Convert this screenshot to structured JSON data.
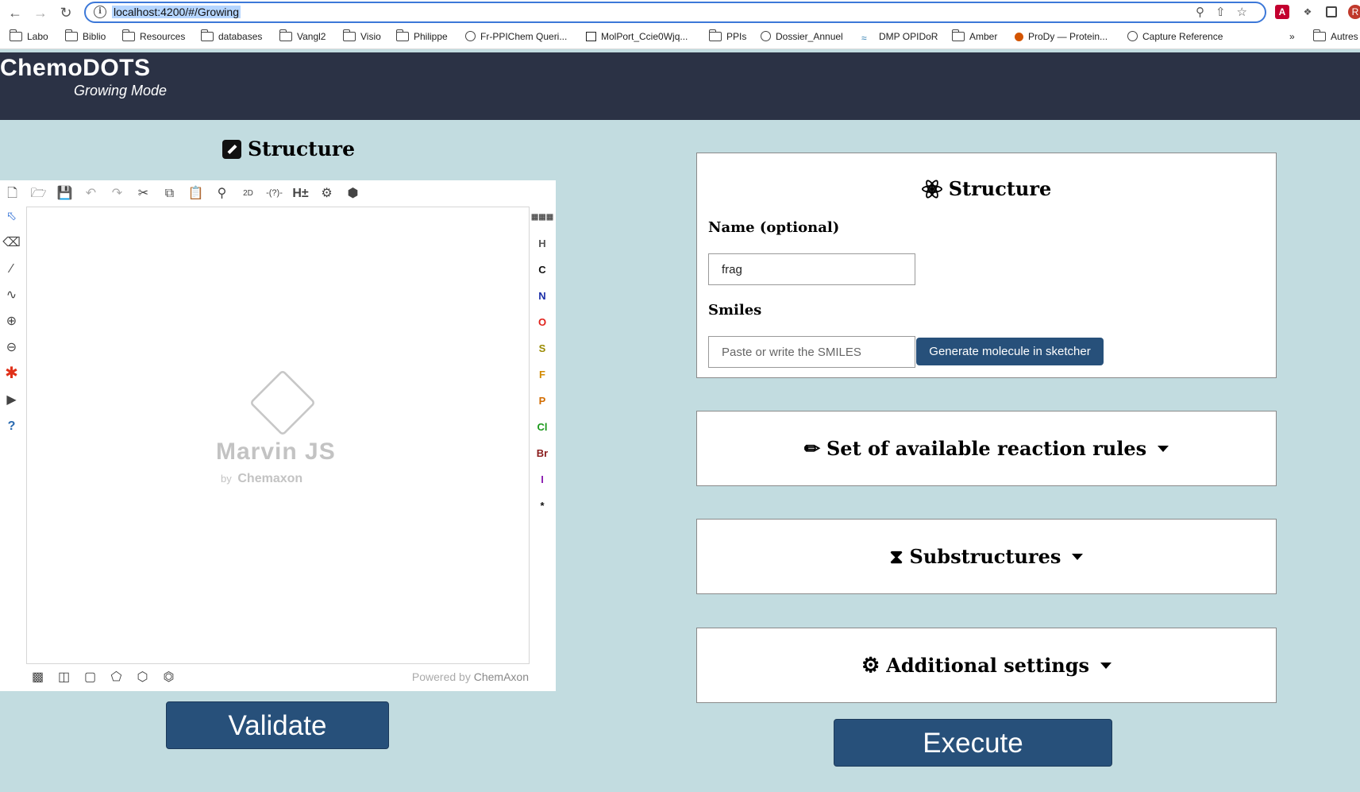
{
  "browser": {
    "url": "localhost:4200/#/Growing",
    "bookmarks": [
      "Labo",
      "Biblio",
      "Resources",
      "databases",
      "Vangl2",
      "Visio",
      "Philippe",
      "Fr-PPIChem Queri...",
      "MolPort_Ccie0Wjq...",
      "PPIs",
      "Dossier_Annuel",
      "DMP OPIDoR",
      "Amber",
      "ProDy — Protein...",
      "Capture Reference",
      "Autres"
    ],
    "more_label": "»"
  },
  "app": {
    "title": "ChemoDOTS",
    "subtitle": "Growing Mode"
  },
  "sketcher": {
    "heading": "Structure",
    "logo_name": "Marvin JS",
    "logo_by": "by",
    "logo_company": "Chemaxon",
    "powered_prefix": "Powered by",
    "powered_company": "ChemAxon",
    "atoms": [
      {
        "symbol": "H",
        "color": "#555555"
      },
      {
        "symbol": "C",
        "color": "#111111"
      },
      {
        "symbol": "N",
        "color": "#1c2fa8"
      },
      {
        "symbol": "O",
        "color": "#e0211a"
      },
      {
        "symbol": "S",
        "color": "#9a8a00"
      },
      {
        "symbol": "F",
        "color": "#d28a00"
      },
      {
        "symbol": "P",
        "color": "#d26c00"
      },
      {
        "symbol": "Cl",
        "color": "#1c9a1c"
      },
      {
        "symbol": "Br",
        "color": "#8a1c1c"
      },
      {
        "symbol": "I",
        "color": "#8a1cb0"
      },
      {
        "symbol": "*",
        "color": "#111111"
      }
    ],
    "validate_label": "Validate"
  },
  "structure_panel": {
    "heading": "Structure",
    "name_label": "Name (optional)",
    "name_value": "frag",
    "smiles_label": "Smiles",
    "smiles_placeholder": "Paste or write the SMILES",
    "generate_label": "Generate molecule in sketcher"
  },
  "panels": {
    "reaction_rules": "Set of available reaction rules",
    "substructures": "Substructures",
    "additional_settings": "Additional settings"
  },
  "execute_label": "Execute",
  "colors": {
    "background": "#c2dce0",
    "header": "#2b3245",
    "button": "#27507a"
  }
}
